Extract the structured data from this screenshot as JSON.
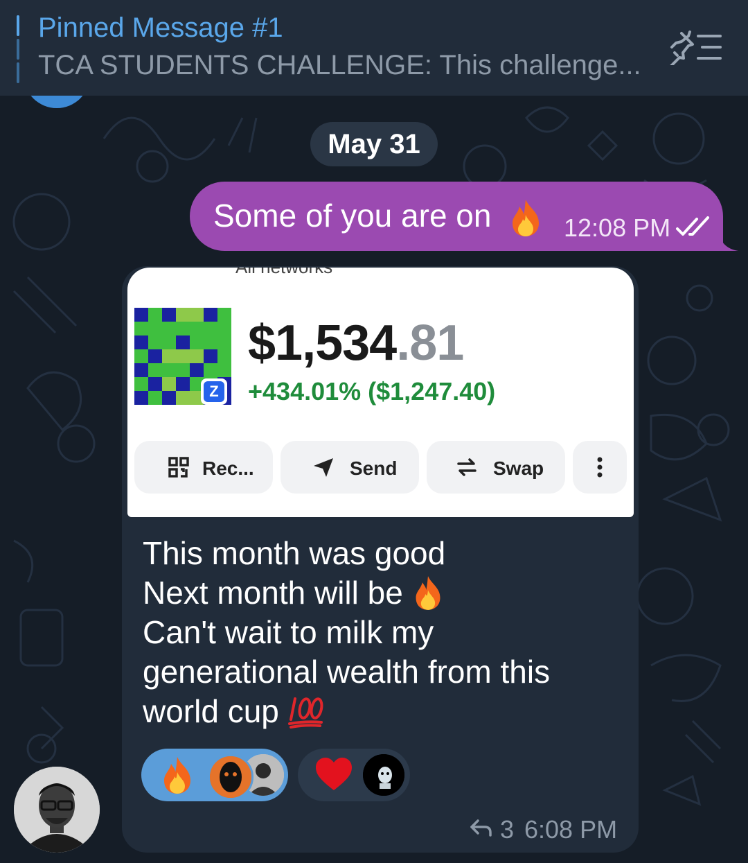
{
  "pinned": {
    "title": "Pinned Message #1",
    "snippet": "TCA STUDENTS CHALLENGE:   This challenge..."
  },
  "date_separator": "May 31",
  "outgoing": {
    "text": "Some of you are on",
    "emoji": "fire",
    "time": "12:08 PM",
    "status": "read-double-check"
  },
  "incoming": {
    "wallet": {
      "network": "All networks",
      "amount_main": "$1,534",
      "amount_cents": ".81",
      "change": "+434.01% ($1,247.40)",
      "badge": "Z",
      "buttons": {
        "receive": "Rec...",
        "send": "Send",
        "swap": "Swap"
      }
    },
    "lines": [
      "This month was good",
      "Next month will be",
      "Can't wait to milk my",
      "generational wealth from this",
      "world cup"
    ],
    "line_emojis": [
      "fire",
      "hundred-points"
    ],
    "reactions": [
      {
        "emoji": "fire",
        "selected": true
      },
      {
        "emoji": "red-heart",
        "selected": false
      }
    ],
    "reply_count": "3",
    "time": "6:08 PM"
  },
  "colors": {
    "background": "#151d27",
    "header": "#212c3a",
    "outgoing_bubble": "#9b4ab1",
    "incoming_bubble": "#212c3a",
    "link_blue": "#5aa7ea",
    "gain_green": "#1f8c3b"
  }
}
